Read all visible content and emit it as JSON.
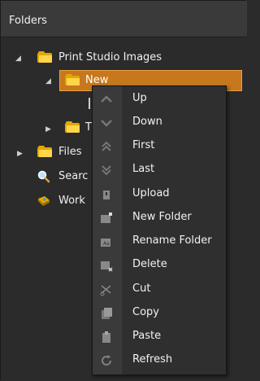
{
  "panel": {
    "title": "Folders"
  },
  "tree": {
    "root": {
      "label": "Print Studio Images"
    },
    "child_selected": {
      "label": "New"
    },
    "child_partial": {
      "label": "T"
    },
    "files": {
      "label": "Files"
    },
    "search": {
      "label": "Searc"
    },
    "work": {
      "label": "Work"
    }
  },
  "context_menu": {
    "items": [
      {
        "label": "Up",
        "icon": "up-arrow-icon"
      },
      {
        "label": "Down",
        "icon": "down-arrow-icon"
      },
      {
        "label": "First",
        "icon": "double-up-arrow-icon"
      },
      {
        "label": "Last",
        "icon": "double-down-arrow-icon"
      },
      {
        "label": "Upload",
        "icon": "upload-icon"
      },
      {
        "label": "New Folder",
        "icon": "new-folder-icon"
      },
      {
        "label": "Rename Folder",
        "icon": "rename-folder-icon"
      },
      {
        "label": "Delete",
        "icon": "delete-folder-icon"
      },
      {
        "label": "Cut",
        "icon": "scissors-icon"
      },
      {
        "label": "Copy",
        "icon": "copy-icon"
      },
      {
        "label": "Paste",
        "icon": "paste-icon"
      },
      {
        "label": "Refresh",
        "icon": "refresh-icon"
      }
    ]
  },
  "colors": {
    "selection": "#c7771c",
    "folder": "#ffd54a",
    "background": "#2b2b2b"
  }
}
